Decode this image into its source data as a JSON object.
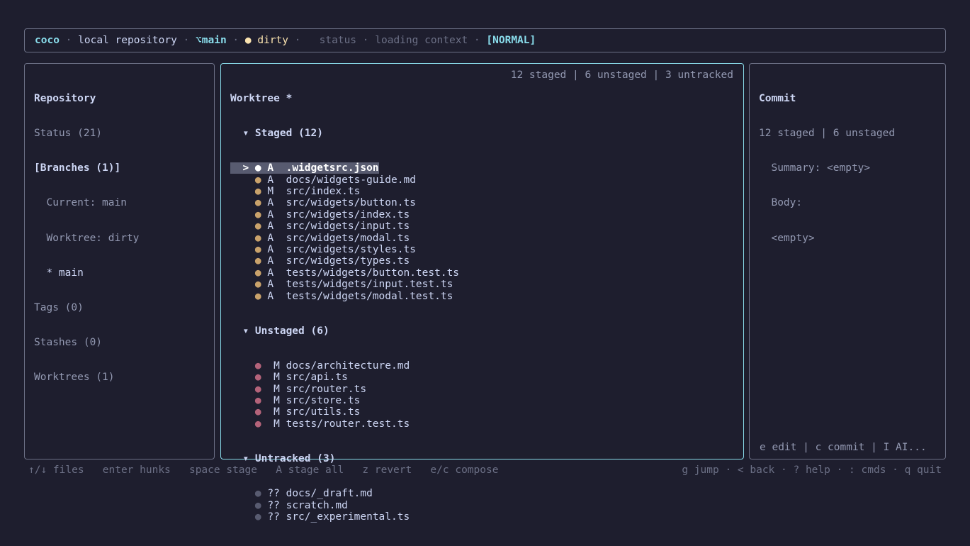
{
  "status_bar": {
    "app": "coco",
    "repo": "local repository",
    "branch_icon": "⌥",
    "branch": "main",
    "dirty_icon": "●",
    "dirty": "dirty",
    "sep": "·",
    "status_label": "status",
    "context": "loading context",
    "mode": "[NORMAL]"
  },
  "repository": {
    "title": "Repository",
    "status": "Status (21)",
    "branches": "[Branches (1)]",
    "current": "  Current: main",
    "worktree": "  Worktree: dirty",
    "main": "  * main",
    "tags": "Tags (0)",
    "stashes": "Stashes (0)",
    "worktrees": "Worktrees (1)"
  },
  "worktree": {
    "title": "Worktree *",
    "summary": "12 staged | 6 unstaged | 3 untracked",
    "staged_header": "  ▾ Staged (12)",
    "staged": [
      {
        "prefix": "  > ",
        "dot": "●",
        "code": "A ",
        "path": ".widgetsrc.json"
      },
      {
        "prefix": "    ",
        "dot": "●",
        "code": "A ",
        "path": "docs/widgets-guide.md"
      },
      {
        "prefix": "    ",
        "dot": "●",
        "code": "M ",
        "path": "src/index.ts"
      },
      {
        "prefix": "    ",
        "dot": "●",
        "code": "A ",
        "path": "src/widgets/button.ts"
      },
      {
        "prefix": "    ",
        "dot": "●",
        "code": "A ",
        "path": "src/widgets/index.ts"
      },
      {
        "prefix": "    ",
        "dot": "●",
        "code": "A ",
        "path": "src/widgets/input.ts"
      },
      {
        "prefix": "    ",
        "dot": "●",
        "code": "A ",
        "path": "src/widgets/modal.ts"
      },
      {
        "prefix": "    ",
        "dot": "●",
        "code": "A ",
        "path": "src/widgets/styles.ts"
      },
      {
        "prefix": "    ",
        "dot": "●",
        "code": "A ",
        "path": "src/widgets/types.ts"
      },
      {
        "prefix": "    ",
        "dot": "●",
        "code": "A ",
        "path": "tests/widgets/button.test.ts"
      },
      {
        "prefix": "    ",
        "dot": "●",
        "code": "A ",
        "path": "tests/widgets/input.test.ts"
      },
      {
        "prefix": "    ",
        "dot": "●",
        "code": "A ",
        "path": "tests/widgets/modal.test.ts"
      }
    ],
    "unstaged_header": "  ▾ Unstaged (6)",
    "unstaged": [
      {
        "prefix": "    ",
        "dot": "●",
        "code": " M",
        "path": "docs/architecture.md"
      },
      {
        "prefix": "    ",
        "dot": "●",
        "code": " M",
        "path": "src/api.ts"
      },
      {
        "prefix": "    ",
        "dot": "●",
        "code": " M",
        "path": "src/router.ts"
      },
      {
        "prefix": "    ",
        "dot": "●",
        "code": " M",
        "path": "src/store.ts"
      },
      {
        "prefix": "    ",
        "dot": "●",
        "code": " M",
        "path": "src/utils.ts"
      },
      {
        "prefix": "    ",
        "dot": "●",
        "code": " M",
        "path": "tests/router.test.ts"
      }
    ],
    "untracked_header": "  ▾ Untracked (3)",
    "untracked": [
      {
        "prefix": "    ",
        "dot": "●",
        "code": "??",
        "path": "docs/_draft.md"
      },
      {
        "prefix": "    ",
        "dot": "●",
        "code": "??",
        "path": "scratch.md"
      },
      {
        "prefix": "    ",
        "dot": "●",
        "code": "??",
        "path": "src/_experimental.ts"
      }
    ]
  },
  "commit": {
    "title": "Commit",
    "counts": "12 staged | 6 unstaged",
    "summary": "  Summary: <empty>",
    "body": "  Body:",
    "body_value": "  <empty>",
    "hint": "e edit | c commit | I AI..."
  },
  "footer": {
    "left": "↑/↓ files   enter hunks   space stage   A stage all   z revert   e/c compose",
    "right": "g jump · < back · ? help · : cmds · q quit"
  },
  "colors": {
    "accent": "#89dceb",
    "staged_dot": "#c9a26b",
    "unstaged_dot": "#b4637a",
    "untracked_dot": "#585b70",
    "dirty": "#f9e2af"
  }
}
